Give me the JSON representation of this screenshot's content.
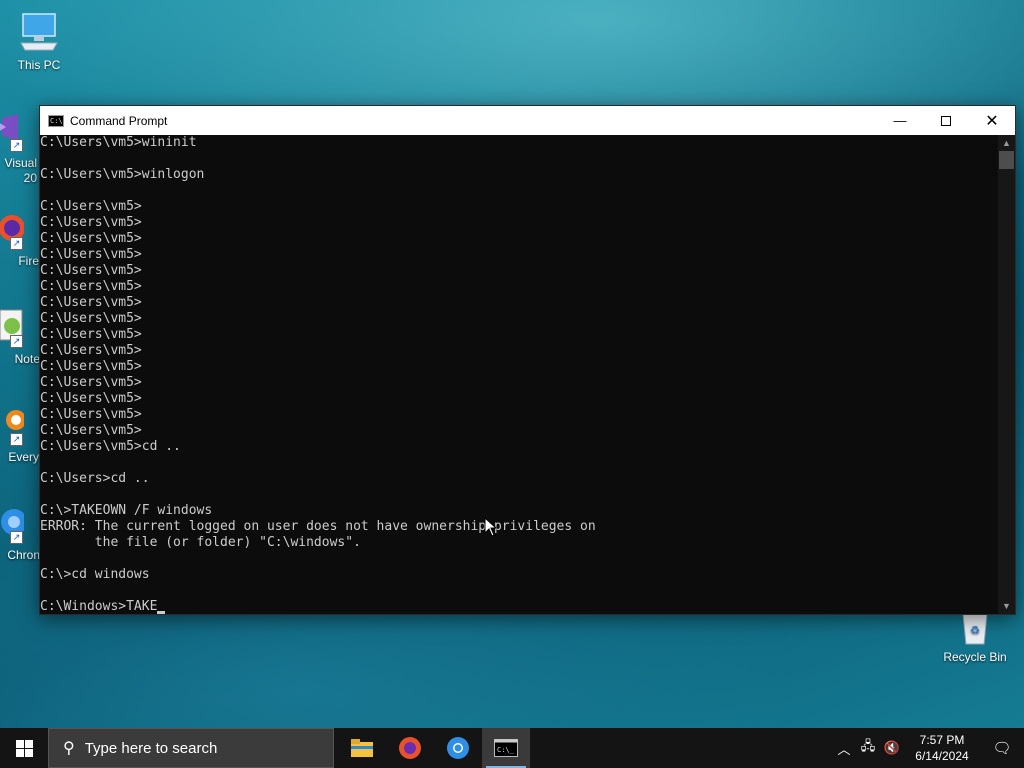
{
  "desktop": {
    "icons": [
      {
        "label": "This PC"
      },
      {
        "label": "Visual Studio 2022",
        "visible_label": "Visual\n20"
      },
      {
        "label": "Firefox",
        "visible_label": "Fire"
      },
      {
        "label": "Notepad++",
        "visible_label": "Note"
      },
      {
        "label": "Everything",
        "visible_label": "Every"
      },
      {
        "label": "Chrome",
        "visible_label": "Chron"
      },
      {
        "label": "Recycle Bin"
      }
    ]
  },
  "cmd": {
    "title": "Command Prompt",
    "lines": [
      "C:\\Users\\vm5>wininit",
      "",
      "C:\\Users\\vm5>winlogon",
      "",
      "C:\\Users\\vm5>",
      "C:\\Users\\vm5>",
      "C:\\Users\\vm5>",
      "C:\\Users\\vm5>",
      "C:\\Users\\vm5>",
      "C:\\Users\\vm5>",
      "C:\\Users\\vm5>",
      "C:\\Users\\vm5>",
      "C:\\Users\\vm5>",
      "C:\\Users\\vm5>",
      "C:\\Users\\vm5>",
      "C:\\Users\\vm5>",
      "C:\\Users\\vm5>",
      "C:\\Users\\vm5>",
      "C:\\Users\\vm5>",
      "C:\\Users\\vm5>cd ..",
      "",
      "C:\\Users>cd ..",
      "",
      "C:\\>TAKEOWN /F windows",
      "ERROR: The current logged on user does not have ownership privileges on",
      "       the file (or folder) \"C:\\windows\".",
      "",
      "C:\\>cd windows",
      ""
    ],
    "current_input": "C:\\Windows>TAKE"
  },
  "taskbar": {
    "search_placeholder": "Type here to search",
    "time": "7:57 PM",
    "date": "6/14/2024"
  }
}
